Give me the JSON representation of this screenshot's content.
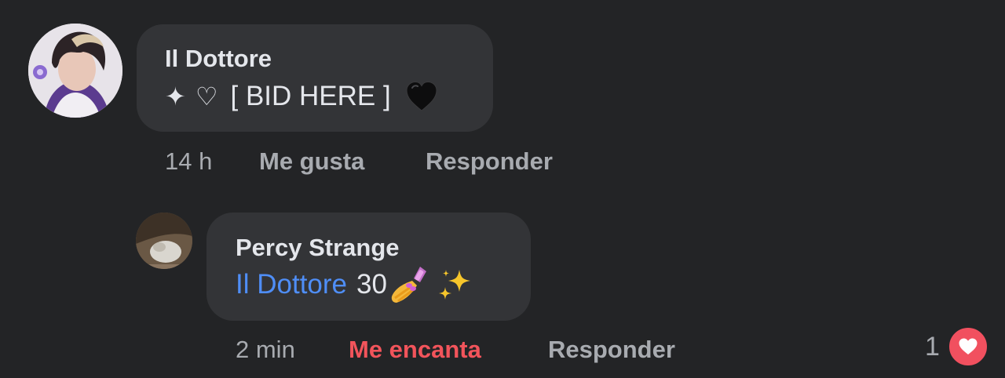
{
  "comments": [
    {
      "author": "Il Dottore",
      "text_sparkle": "✦",
      "text_heart_outline": "♡",
      "text_main": "[ BID HERE ]",
      "text_emoji": "black-heart",
      "time": "14 h",
      "like_label": "Me gusta",
      "reply_label": "Responder"
    },
    {
      "author": "Percy Strange",
      "mention": "Il Dottore",
      "text_main": "30",
      "emojis": [
        "nail-polish",
        "sparkles"
      ],
      "time": "2 min",
      "like_label": "Me encanta",
      "reply_label": "Responder",
      "reaction_count": "1",
      "reaction_icon": "heart-icon"
    }
  ],
  "colors": {
    "background": "#232426",
    "bubble": "#333437",
    "mention": "#4f8ef7",
    "loved": "#f2545b",
    "heart_badge": "#f1505f"
  }
}
